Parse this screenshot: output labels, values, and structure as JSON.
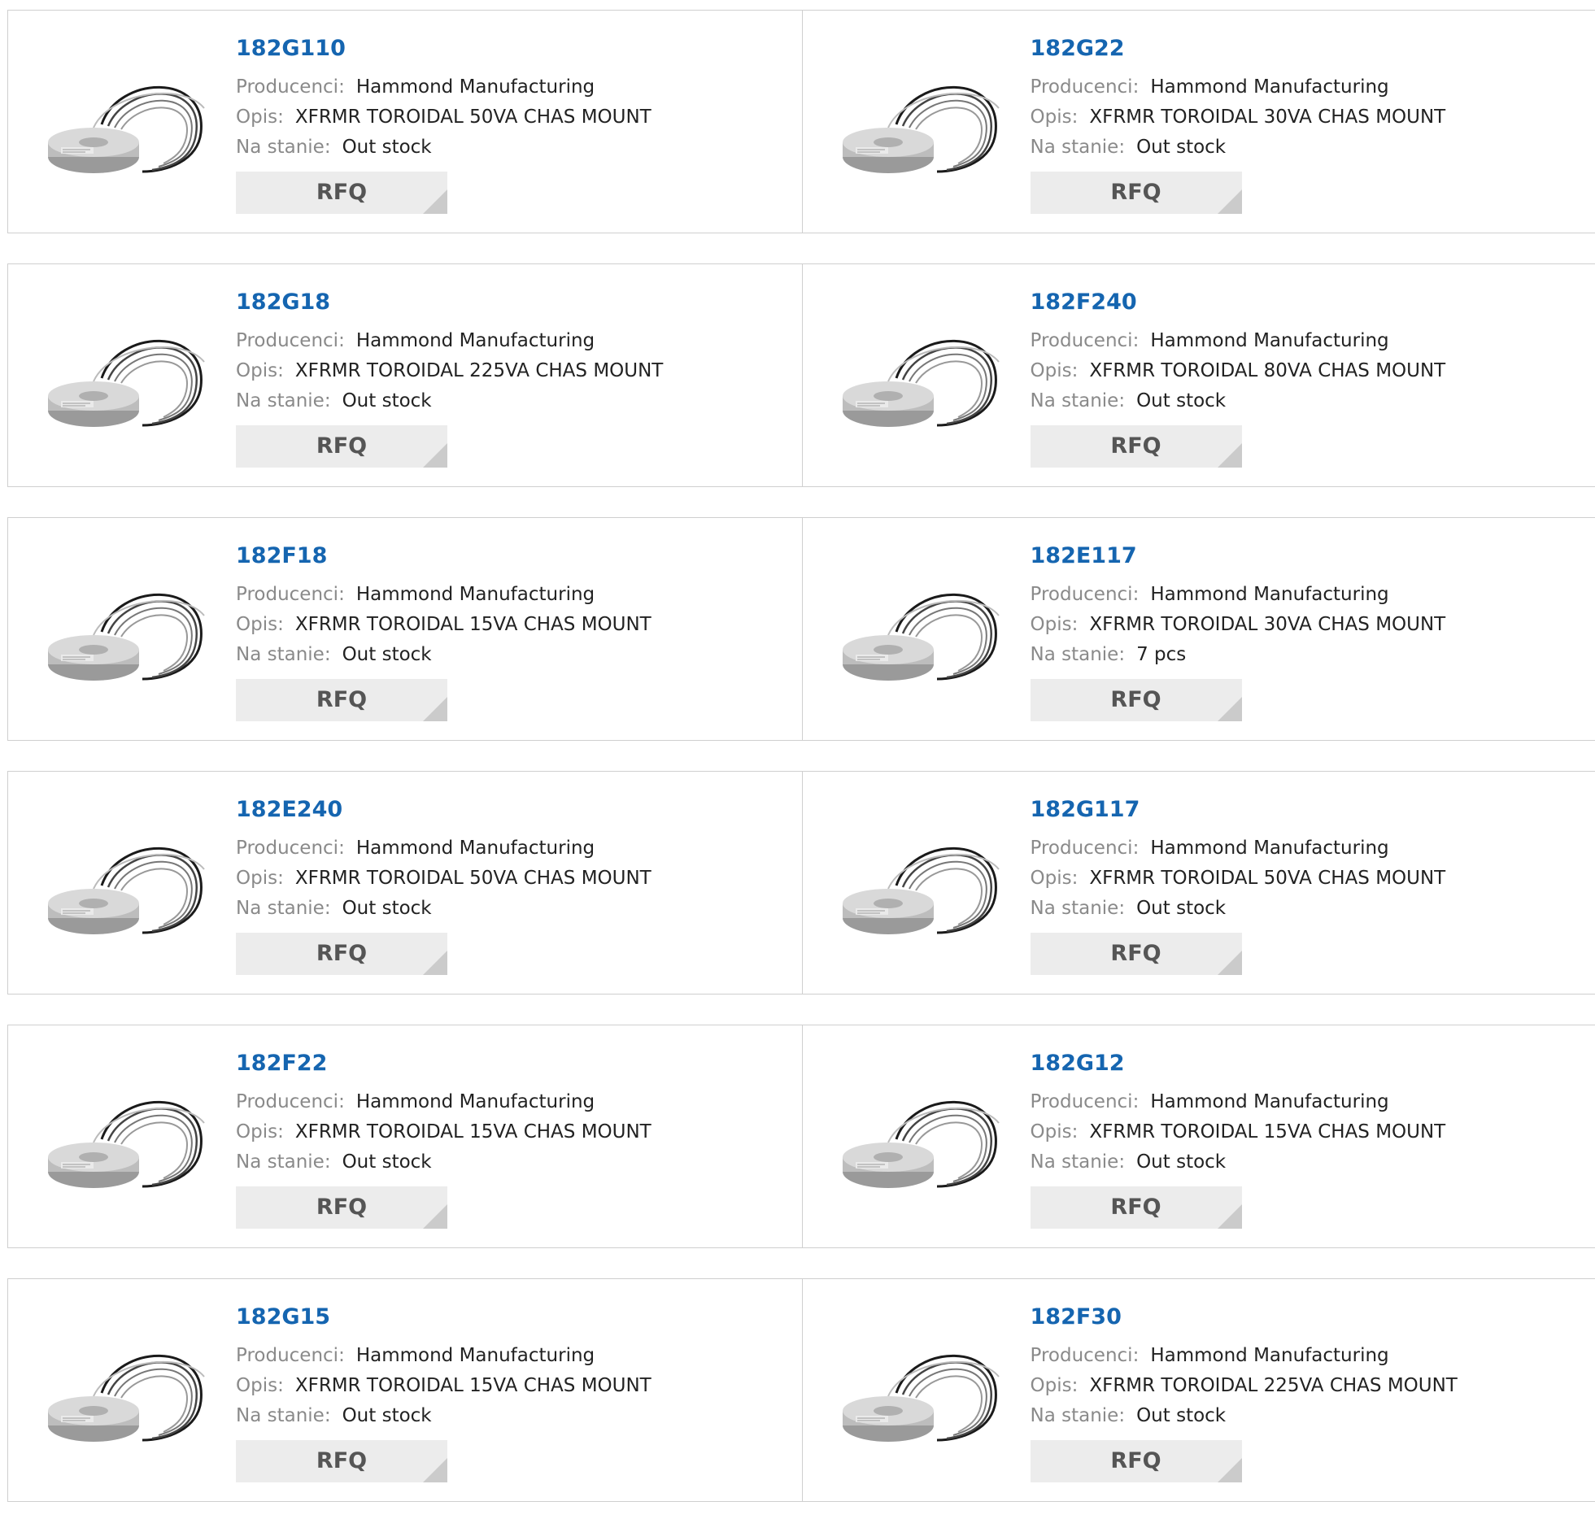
{
  "labels": {
    "manufacturer": "Producenci:",
    "description": "Opis:",
    "stock": "Na stanie:",
    "rfq": "RFQ"
  },
  "colors": {
    "link": "#1565b0",
    "label": "#8a8a8a",
    "rfq_bg": "#ececec",
    "border": "#cfcfcf"
  },
  "products": [
    {
      "part": "182G110",
      "manufacturer": "Hammond Manufacturing",
      "description": "XFRMR TOROIDAL 50VA CHAS MOUNT",
      "stock": "Out stock",
      "image_icon": "toroidal-transformer-icon"
    },
    {
      "part": "182G22",
      "manufacturer": "Hammond Manufacturing",
      "description": "XFRMR TOROIDAL 30VA CHAS MOUNT",
      "stock": "Out stock",
      "image_icon": "toroidal-transformer-icon"
    },
    {
      "part": "182G18",
      "manufacturer": "Hammond Manufacturing",
      "description": "XFRMR TOROIDAL 225VA CHAS MOUNT",
      "stock": "Out stock",
      "image_icon": "toroidal-transformer-icon"
    },
    {
      "part": "182F240",
      "manufacturer": "Hammond Manufacturing",
      "description": "XFRMR TOROIDAL 80VA CHAS MOUNT",
      "stock": "Out stock",
      "image_icon": "toroidal-transformer-icon"
    },
    {
      "part": "182F18",
      "manufacturer": "Hammond Manufacturing",
      "description": "XFRMR TOROIDAL 15VA CHAS MOUNT",
      "stock": "Out stock",
      "image_icon": "toroidal-transformer-icon"
    },
    {
      "part": "182E117",
      "manufacturer": "Hammond Manufacturing",
      "description": "XFRMR TOROIDAL 30VA CHAS MOUNT",
      "stock": "7 pcs",
      "image_icon": "toroidal-transformer-icon"
    },
    {
      "part": "182E240",
      "manufacturer": "Hammond Manufacturing",
      "description": "XFRMR TOROIDAL 50VA CHAS MOUNT",
      "stock": "Out stock",
      "image_icon": "toroidal-transformer-icon"
    },
    {
      "part": "182G117",
      "manufacturer": "Hammond Manufacturing",
      "description": "XFRMR TOROIDAL 50VA CHAS MOUNT",
      "stock": "Out stock",
      "image_icon": "toroidal-transformer-icon"
    },
    {
      "part": "182F22",
      "manufacturer": "Hammond Manufacturing",
      "description": "XFRMR TOROIDAL 15VA CHAS MOUNT",
      "stock": "Out stock",
      "image_icon": "toroidal-transformer-icon"
    },
    {
      "part": "182G12",
      "manufacturer": "Hammond Manufacturing",
      "description": "XFRMR TOROIDAL 15VA CHAS MOUNT",
      "stock": "Out stock",
      "image_icon": "toroidal-transformer-icon"
    },
    {
      "part": "182G15",
      "manufacturer": "Hammond Manufacturing",
      "description": "XFRMR TOROIDAL 15VA CHAS MOUNT",
      "stock": "Out stock",
      "image_icon": "toroidal-transformer-icon"
    },
    {
      "part": "182F30",
      "manufacturer": "Hammond Manufacturing",
      "description": "XFRMR TOROIDAL 225VA CHAS MOUNT",
      "stock": "Out stock",
      "image_icon": "toroidal-transformer-icon"
    }
  ]
}
